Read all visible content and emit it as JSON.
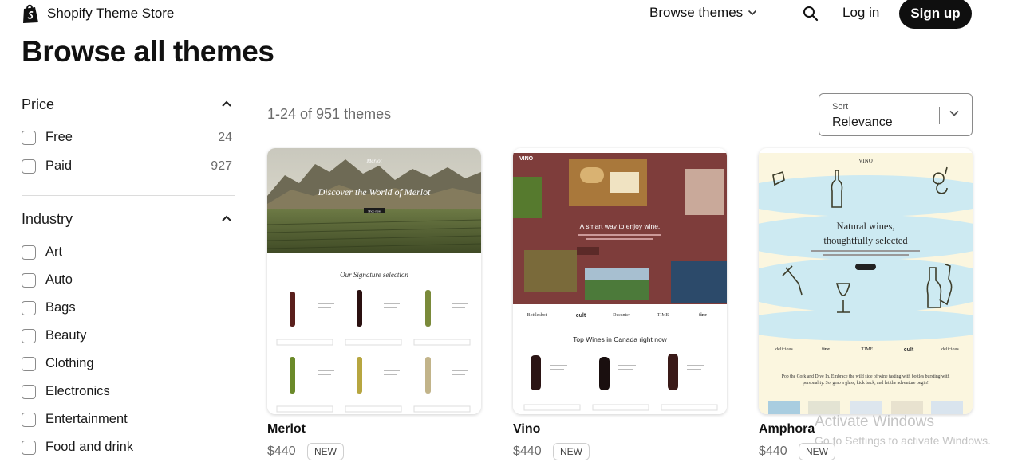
{
  "header": {
    "brand": "Shopify Theme Store",
    "browse_label": "Browse themes",
    "login_label": "Log in",
    "signup_label": "Sign up"
  },
  "page_title": "Browse all themes",
  "filters": {
    "price": {
      "title": "Price",
      "options": [
        {
          "label": "Free",
          "count": "24"
        },
        {
          "label": "Paid",
          "count": "927"
        }
      ]
    },
    "industry": {
      "title": "Industry",
      "options": [
        {
          "label": "Art"
        },
        {
          "label": "Auto"
        },
        {
          "label": "Bags"
        },
        {
          "label": "Beauty"
        },
        {
          "label": "Clothing"
        },
        {
          "label": "Electronics"
        },
        {
          "label": "Entertainment"
        },
        {
          "label": "Food and drink"
        }
      ]
    }
  },
  "results": {
    "count_text": "1-24 of 951 themes",
    "sort_caption": "Sort",
    "sort_value": "Relevance"
  },
  "themes": [
    {
      "name": "Merlot",
      "price": "$440",
      "badge": "NEW",
      "preview": {
        "hero_text": "Discover the World of Merlot",
        "section_text": "Our Signature selection",
        "button": "Shop now",
        "brand": "Merlot"
      }
    },
    {
      "name": "Vino",
      "price": "$440",
      "badge": "NEW",
      "preview": {
        "logo": "VINO",
        "hero_text": "A smart way to enjoy wine.",
        "section_text": "Top Wines in Canada right now",
        "logos": [
          "Bottleshot",
          "cult",
          "Decanter",
          "TIME",
          "fine"
        ]
      }
    },
    {
      "name": "Amphora",
      "price": "$440",
      "badge": "NEW",
      "preview": {
        "logo": "VINO",
        "hero_line1": "Natural wines,",
        "hero_line2": "thoughtfully selected",
        "logos": [
          "delicious",
          "fine",
          "TIME",
          "cult",
          "delicious"
        ],
        "body_text": "Pop the Cork and Dive In. Embrace the wild side of wine tasting with bottles bursting with personality. So, grab a glass, kick back, and let the adventure begin!"
      }
    }
  ],
  "system_overlay": {
    "line1": "Activate Windows",
    "line2": "Go to Settings to activate Windows."
  },
  "colors": {
    "signup_bg": "#0f0f0f",
    "vino_bg": "#7e3d3b",
    "amphora_sky": "#cdeaf2",
    "amphora_cream": "#fbf6df"
  },
  "icons": [
    "shopify-bag-icon",
    "chevron-down-icon",
    "search-icon",
    "chevron-up-icon",
    "checkbox-icon"
  ]
}
